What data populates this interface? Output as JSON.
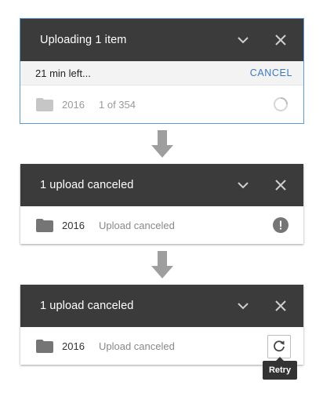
{
  "panel1": {
    "title": "Uploading 1 item",
    "time_left": "21 min left...",
    "cancel_label": "CANCEL",
    "file_name": "2016",
    "file_progress": "1 of 354"
  },
  "panel2": {
    "title": "1 upload canceled",
    "file_name": "2016",
    "file_status": "Upload canceled"
  },
  "panel3": {
    "title": "1 upload canceled",
    "file_name": "2016",
    "file_status": "Upload canceled",
    "retry_tooltip": "Retry"
  },
  "icons": {
    "collapse": "chevron-down-icon",
    "close": "close-icon",
    "folder": "folder-icon",
    "spinner": "loading-spinner-icon",
    "error": "error-icon",
    "retry": "retry-icon",
    "flow": "arrow-down-icon"
  },
  "colors": {
    "header_bg": "#3b3b3b",
    "accent": "#3b79c4",
    "icon_gray": "#757575",
    "selection": "#5b9bd8"
  }
}
